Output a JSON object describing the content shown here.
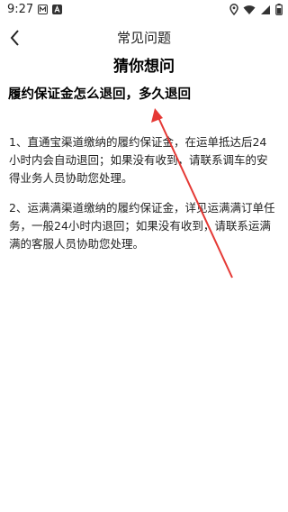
{
  "status_bar": {
    "time": "9:27",
    "left_icons": [
      "notification-m-icon",
      "notification-a-icon"
    ],
    "right_icons": [
      "location-icon",
      "wifi-icon",
      "signal-icon",
      "battery-icon"
    ]
  },
  "nav": {
    "back_icon": "chevron-left-icon",
    "title": "常见问题"
  },
  "content": {
    "heading": "猜你想问",
    "question": "履约保证金怎么退回，多久退回",
    "answers": [
      "1、直通宝渠道缴纳的履约保证金，在运单抵达后24小时内会自动退回；如果没有收到，请联系调车的安得业务人员协助您处理。",
      "2、运满满渠道缴纳的履约保证金，详见运满满订单任务，一般24小时内退回；如果没有收到，请联系运满满的客服人员协助您处理。"
    ]
  },
  "annotation": {
    "arrow_color": "#e53935"
  }
}
